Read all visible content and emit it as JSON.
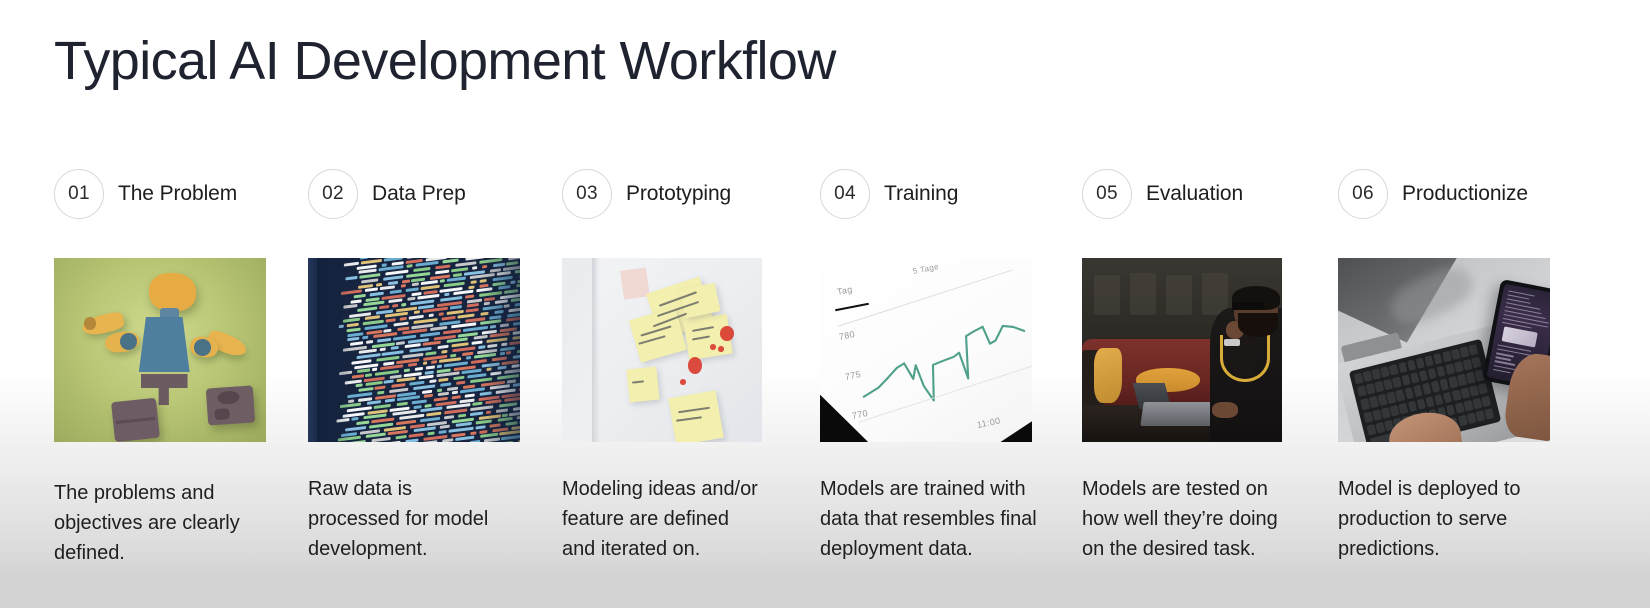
{
  "page": {
    "title": "Typical AI Development Workflow",
    "background_top": "#ffffff",
    "background_bottom": "#d2d2d2",
    "title_color": "#1f2330"
  },
  "steps": [
    {
      "number": "01",
      "label": "The Problem",
      "caption": "The problems and\nobjectives are clearly\ndefined.",
      "image_alt": "disassembled-lego-minifigure-on-green-background"
    },
    {
      "number": "02",
      "label": "Data Prep",
      "caption": "Raw data is\nprocessed for model\ndevelopment.",
      "image_alt": "dense-colorful-code-on-dark-blue-screen"
    },
    {
      "number": "03",
      "label": "Prototyping",
      "caption": "Modeling ideas and/or\nfeature are defined\nand iterated  on.",
      "image_alt": "yellow-sticky-notes-with-handwriting-on-whiteboard"
    },
    {
      "number": "04",
      "label": "Training",
      "caption": "Models are trained with\ndata that resembles final\ndeployment data.",
      "image_alt": "angled-photo-of-line-chart-on-screen"
    },
    {
      "number": "05",
      "label": "Evaluation",
      "caption": "Models are tested on\nhow well they’re doing\non the desired task.",
      "image_alt": "man-working-on-laptop-in-dark-lounge"
    },
    {
      "number": "06",
      "label": "Productionize",
      "caption": "Model is deployed to\nproduction to serve\npredictions.",
      "image_alt": "overhead-view-of-laptop-keyboard-and-smartphone"
    }
  ],
  "chart_thumbnail": {
    "type": "line",
    "legend": "Tag",
    "ylabel_ticks": [
      "780",
      "775",
      "770"
    ],
    "xlabel_ticks": [
      "11:00"
    ],
    "line_color": "#4fa08a",
    "note": "5 Tage"
  }
}
